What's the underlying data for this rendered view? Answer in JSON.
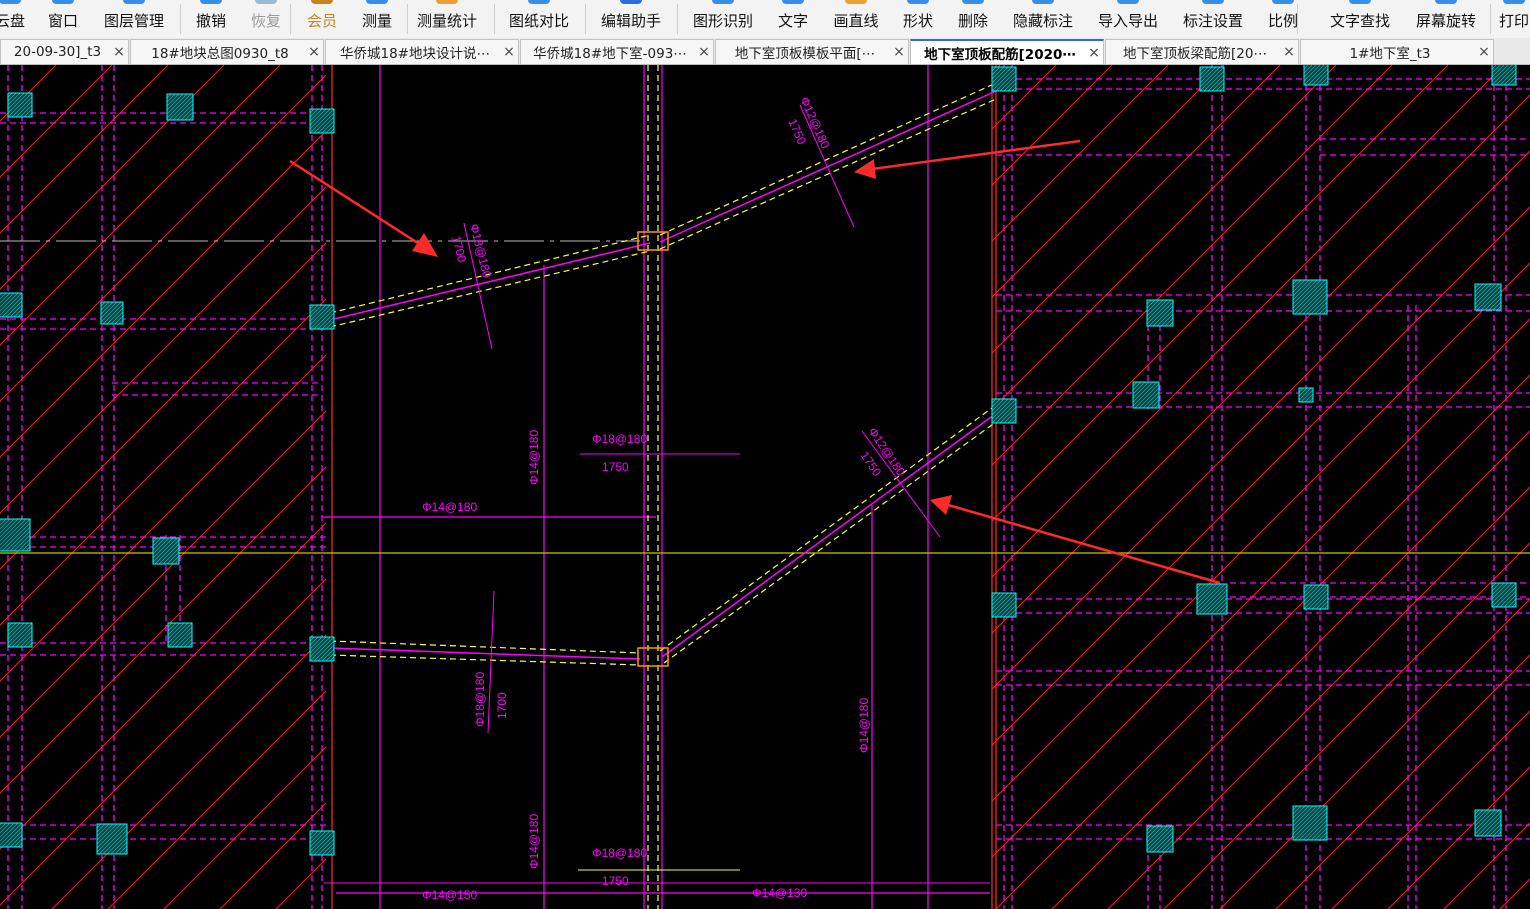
{
  "toolbar": {
    "items": [
      {
        "label": "云盘",
        "icon": "cloud-icon"
      },
      {
        "label": "窗口",
        "icon": "window-icon"
      },
      {
        "label": "图层管理",
        "icon": "layers-icon"
      },
      {
        "label": "撤销",
        "icon": "undo-icon"
      },
      {
        "label": "恢复",
        "icon": "redo-icon",
        "disabled": true
      },
      {
        "label": "会员",
        "icon": "vip-icon",
        "vip": true
      },
      {
        "label": "测量",
        "icon": "measure-icon"
      },
      {
        "label": "测量统计",
        "icon": "measure-stats-icon"
      },
      {
        "label": "图纸对比",
        "icon": "compare-icon"
      },
      {
        "label": "编辑助手",
        "icon": "edit-assistant-icon"
      },
      {
        "label": "图形识别",
        "icon": "shape-recognize-icon"
      },
      {
        "label": "文字",
        "icon": "text-icon"
      },
      {
        "label": "画直线",
        "icon": "line-icon"
      },
      {
        "label": "形状",
        "icon": "shape-icon"
      },
      {
        "label": "删除",
        "icon": "delete-icon"
      },
      {
        "label": "隐藏标注",
        "icon": "hide-annotation-icon"
      },
      {
        "label": "导入导出",
        "icon": "import-export-icon"
      },
      {
        "label": "标注设置",
        "icon": "annotation-settings-icon"
      },
      {
        "label": "比例",
        "icon": "scale-icon"
      },
      {
        "label": "文字查找",
        "icon": "text-search-icon"
      },
      {
        "label": "屏幕旋转",
        "icon": "rotate-screen-icon"
      },
      {
        "label": "打印",
        "icon": "print-icon"
      }
    ]
  },
  "tabs": [
    {
      "title": "20-09-30]_t3",
      "active": false
    },
    {
      "title": "18#地块总图0930_t8",
      "active": false
    },
    {
      "title": "华侨城18#地块设计说⋯",
      "active": false
    },
    {
      "title": "华侨城18#地下室-093⋯",
      "active": false
    },
    {
      "title": "地下室顶板模板平面[⋯",
      "active": false
    },
    {
      "title": "地下室顶板配筋[2020⋯",
      "active": true
    },
    {
      "title": "地下室顶板梁配筋[20⋯",
      "active": false
    },
    {
      "title": "1#地下室_t3",
      "active": false
    }
  ],
  "tab_close_glyph": "×",
  "drawing": {
    "labels": {
      "rebar_ll": "Φ18@180",
      "len_ll": "1700",
      "rebar_ul": "Φ12@180",
      "len_ul": "1750",
      "rebar_lr": "Φ12@180",
      "len_lr": "1750",
      "rebar_mid": "Φ18@180",
      "len_mid": "1750",
      "rebar_v1": "Φ14@180",
      "rebar_h1": "Φ14@180",
      "rebar_bottom_left": "Φ18@180",
      "len_bottom_left": "1700",
      "rebar_v_bottom": "Φ14@180",
      "rebar_v_right": "Φ14@180",
      "rebar_mid_bottom": "Φ18@180",
      "len_mid_bottom": "1750",
      "rebar_bottom_150": "Φ14@150",
      "rebar_bottom_130": "Φ14@130"
    },
    "colors": {
      "grid_magenta": "#ff00ff",
      "hatch_red": "#ff2020",
      "column_cyan": "#00ffff",
      "dash_yellow": "#ffff44",
      "ref_line": "#c8c800",
      "arrow_red": "#ff2a2a",
      "beam_orange": "#ff9900"
    }
  }
}
